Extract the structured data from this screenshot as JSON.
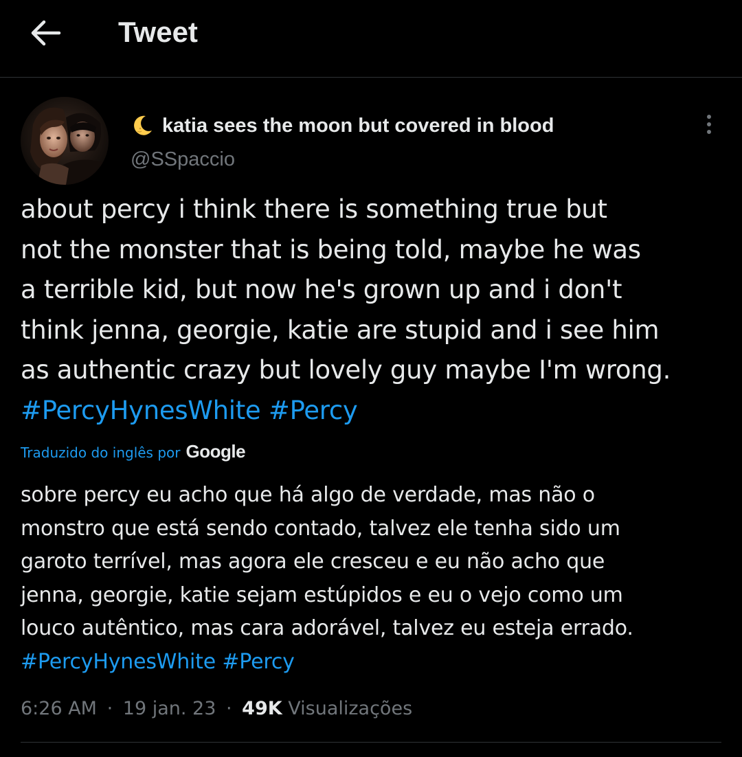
{
  "header": {
    "title": "Tweet"
  },
  "tweet": {
    "display_name": "katia sees the moon but covered in blood",
    "handle": "@SSpaccio",
    "text_lines": [
      "about percy i think there is something true but",
      "not the monster that is being told, maybe he was",
      "a terrible kid, but now he's grown up and i don't",
      "think jenna, georgie, katie are stupid and i see him",
      "as authentic crazy but lovely guy maybe I'm wrong."
    ],
    "hashtags": [
      "#PercyHynesWhite",
      "#Percy"
    ],
    "translation": {
      "label": "Traduzido do inglês por",
      "provider": "Google",
      "text_lines": [
        "sobre percy eu acho que há algo de verdade, mas não o",
        "monstro que está sendo contado, talvez ele tenha sido um",
        "garoto terrível, mas agora ele cresceu e eu não acho que",
        "jenna, georgie, katie sejam estúpidos e eu o vejo como um",
        "louco autêntico, mas cara adorável, talvez eu esteja errado."
      ],
      "hashtags": [
        "#PercyHynesWhite",
        "#Percy"
      ]
    },
    "meta": {
      "time": "6:26 AM",
      "separator": "·",
      "date": "19 jan. 23",
      "views_count": "49K",
      "views_label": "Visualizações"
    }
  },
  "icons": {
    "back": "arrow-left-icon",
    "moon": "crescent-moon-emoji-icon",
    "more": "more-vertical-icon"
  },
  "colors": {
    "background": "#000000",
    "text_primary": "#e7e9ea",
    "text_secondary": "#71767b",
    "link": "#1d9bf0",
    "divider": "#2f3336"
  }
}
